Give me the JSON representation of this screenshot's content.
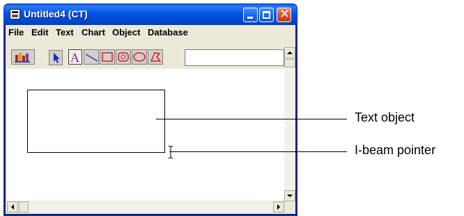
{
  "window": {
    "title": "Untitled4 (CT)"
  },
  "menu": [
    "File",
    "Edit",
    "Text",
    "Chart",
    "Object",
    "Database"
  ],
  "toolbar": {
    "tools": [
      "chart-icon",
      "arrow-pointer-icon",
      "text-tool-icon",
      "line-tool-icon",
      "rectangle-tool-icon",
      "rounded-rectangle-tool-icon",
      "ellipse-tool-icon",
      "polygon-tool-icon"
    ],
    "input_value": ""
  },
  "callouts": {
    "text_object": "Text object",
    "ibeam_pointer": "I-beam pointer"
  }
}
